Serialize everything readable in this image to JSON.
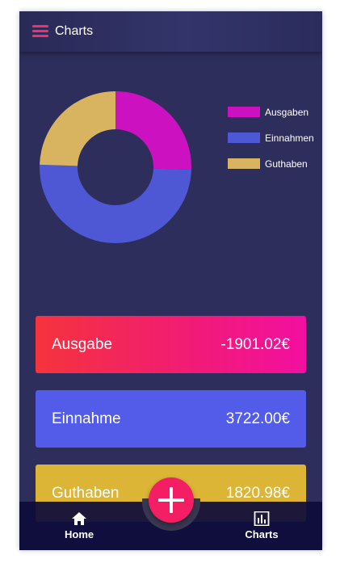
{
  "appbar": {
    "title": "Charts",
    "menu_icon": "hamburger-menu-icon"
  },
  "legend": [
    {
      "label": "Ausgaben",
      "color": "#cc11c0"
    },
    {
      "label": "Einnahmen",
      "color": "#4e58d4"
    },
    {
      "label": "Guthaben",
      "color": "#d8b461"
    }
  ],
  "chart_data": {
    "type": "pie",
    "donut": true,
    "categories": [
      "Ausgaben",
      "Einnahmen",
      "Guthaben"
    ],
    "values": [
      1901.02,
      3722.0,
      1820.98
    ],
    "colors": [
      "#cc11c0",
      "#4e58d4",
      "#d8b461"
    ],
    "legend_position": "right"
  },
  "cards": [
    {
      "label": "Ausgabe",
      "value": "-1901.02€",
      "color": "#f11a78"
    },
    {
      "label": "Einnahme",
      "value": "3722.00€",
      "color": "#525ce8"
    },
    {
      "label": "Guthaben",
      "value": "1820.98€",
      "color": "#dcb436"
    }
  ],
  "nav": {
    "home": {
      "label": "Home",
      "icon": "home-icon"
    },
    "charts": {
      "label": "Charts",
      "icon": "bar-chart-icon"
    },
    "fab_icon": "plus-icon"
  }
}
